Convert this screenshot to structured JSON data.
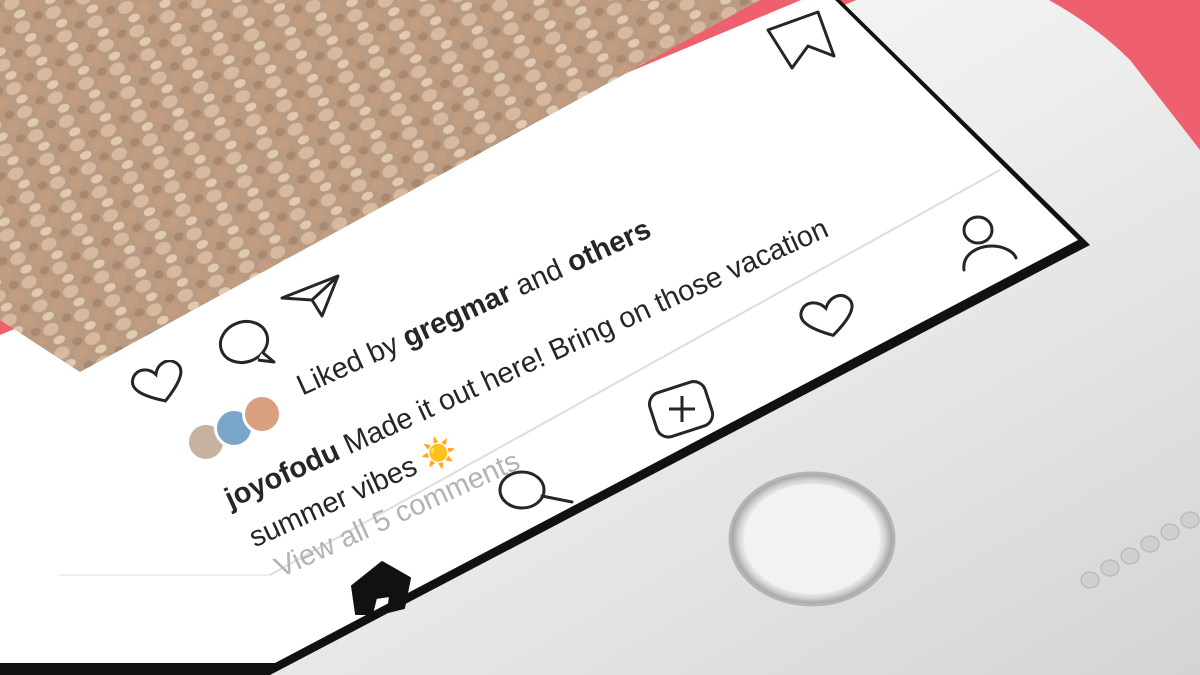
{
  "post": {
    "liked_prefix": "Liked by",
    "liked_user": "gregmar",
    "liked_and": "and",
    "liked_others": "others",
    "caption_user": "joyofodu",
    "caption_line1": "Made it out here! Bring on those vacation",
    "caption_line2": "summer vibes",
    "caption_emoji": "☀️",
    "view_comments": "View all 5 comments"
  },
  "colors": {
    "background": "#ee5f6f",
    "text": "#262626",
    "muted_text": "#b3b3b3"
  },
  "icons": {
    "like": "heart-icon",
    "comment": "comment-bubble-icon",
    "share": "paper-plane-icon",
    "bookmark": "bookmark-icon",
    "home": "home-icon",
    "search": "search-icon",
    "new_post": "plus-square-icon",
    "activity": "heart-outline-icon",
    "profile": "user-icon"
  }
}
